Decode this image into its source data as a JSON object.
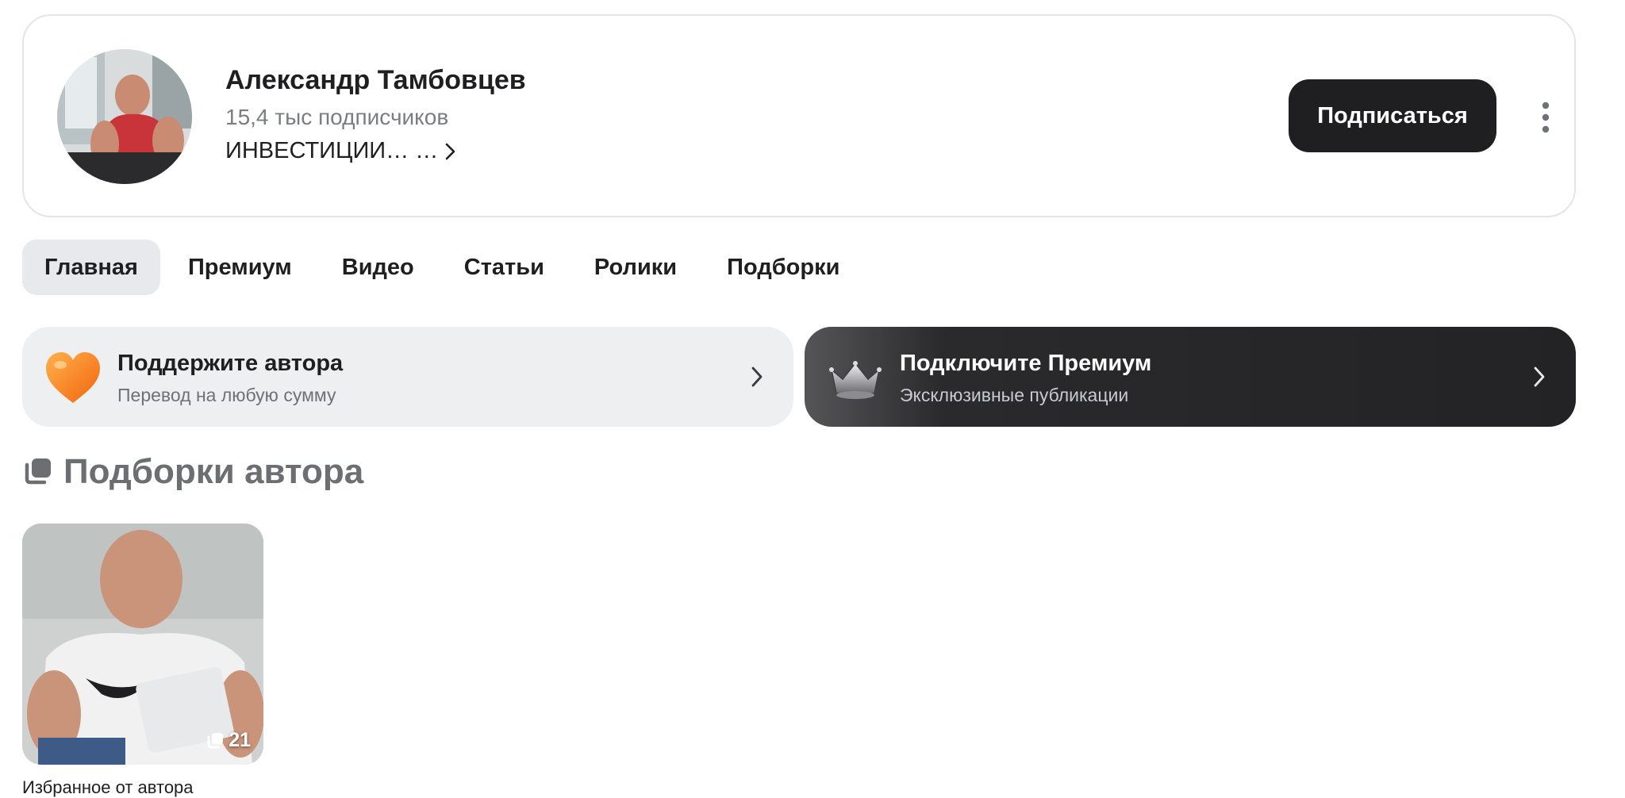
{
  "profile": {
    "name": "Александр Тамбовцев",
    "subscribers": "15,4 тыс подписчиков",
    "description": "ИНВЕСТИЦИИ… …",
    "subscribe_label": "Подписаться"
  },
  "tabs": [
    {
      "label": "Главная",
      "active": true
    },
    {
      "label": "Премиум",
      "active": false
    },
    {
      "label": "Видео",
      "active": false
    },
    {
      "label": "Статьи",
      "active": false
    },
    {
      "label": "Ролики",
      "active": false
    },
    {
      "label": "Подборки",
      "active": false
    }
  ],
  "banners": {
    "support": {
      "title": "Поддержите автора",
      "subtitle": "Перевод на любую сумму",
      "icon": "heart-icon"
    },
    "premium": {
      "title": "Подключите Премиум",
      "subtitle": "Эксклюзивные публикации",
      "icon": "crown-icon"
    }
  },
  "collections_section": {
    "title": "Подборки автора",
    "icon": "collections-icon",
    "items": [
      {
        "title": "Избранное от автора",
        "count": "21"
      }
    ]
  },
  "colors": {
    "accent_dark": "#1f1f21",
    "muted_text": "#7b7d82",
    "heart": "#ff7a1a",
    "active_tab_bg": "#e8e9ec"
  }
}
